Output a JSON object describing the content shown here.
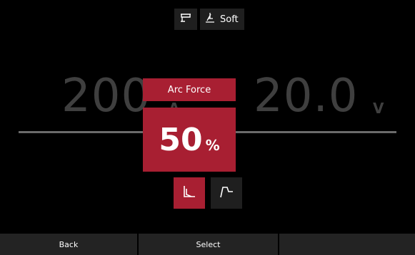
{
  "top_bar": {
    "process_icon": "torch-icon",
    "mode_icon": "soft-start-icon",
    "mode_label": "Soft"
  },
  "readouts": {
    "amperage_value": "200",
    "amperage_unit": "A",
    "voltage_value": "20.0",
    "voltage_unit": "V"
  },
  "arc_force_panel": {
    "title": "Arc Force",
    "value": "50",
    "unit": "%",
    "curve_options": [
      "droop-curve-icon",
      "constant-curve-icon"
    ],
    "selected_curve": "droop-curve-icon"
  },
  "footer": {
    "back_label": "Back",
    "select_label": "Select",
    "third_label": ""
  },
  "colors": {
    "accent": "#a81f32",
    "background": "#000000",
    "chip": "#1f1f1f",
    "dim_text": "#3f3f3f"
  }
}
